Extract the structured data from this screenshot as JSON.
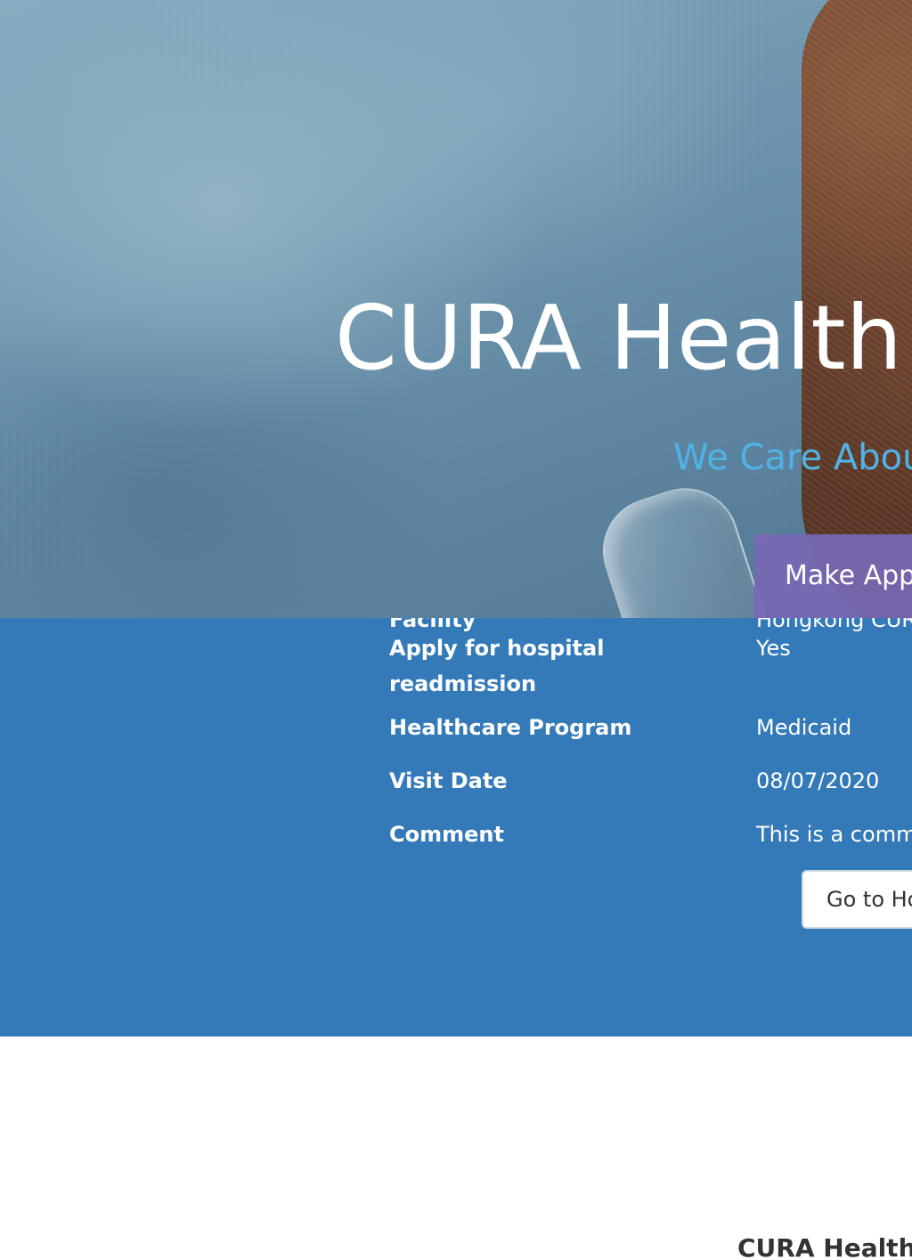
{
  "hero": {
    "title": "CURA Health",
    "subtitle": "We Care Abou",
    "make_appointment_label": "Make App"
  },
  "confirmation": {
    "rows": [
      {
        "label": "Facility",
        "value": "Hongkong CUR"
      },
      {
        "label": "Apply for hospital readmission",
        "value": "Yes"
      },
      {
        "label": "Healthcare Program",
        "value": "Medicaid"
      },
      {
        "label": "Visit Date",
        "value": "08/07/2020"
      },
      {
        "label": "Comment",
        "value": "This is a comme"
      }
    ],
    "go_home_label": "Go to Ho"
  },
  "footer": {
    "brand": "CURA Health"
  },
  "colors": {
    "panel_background": "#347ab8",
    "subtitle": "#4fb3e6",
    "appointment_button": "#7868b4"
  }
}
